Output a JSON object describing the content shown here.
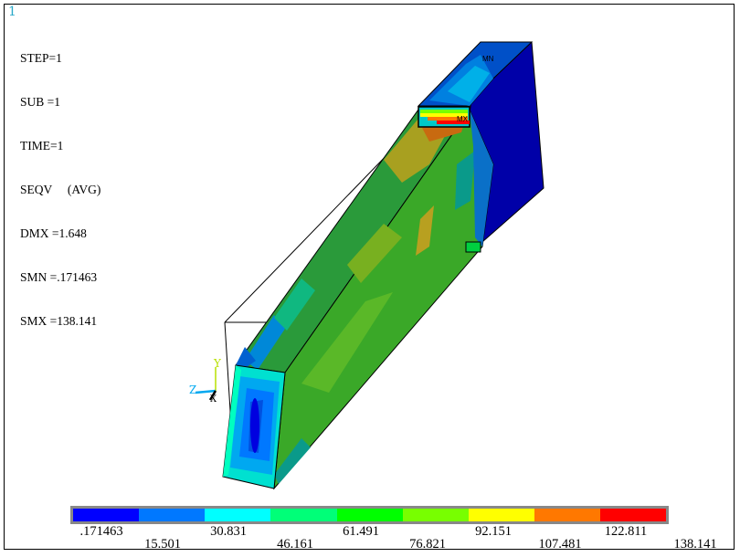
{
  "window_number": "1",
  "info": {
    "step": "STEP=1",
    "sub": "SUB =1",
    "time": "TIME=1",
    "result": "SEQV     (AVG)",
    "dmx": "DMX =1.648",
    "smn": "SMN =.171463",
    "smx": "SMX =138.141"
  },
  "markers": {
    "min": "MN",
    "max": "MX"
  },
  "triad": {
    "x": "X",
    "y": "Y",
    "z": "Z"
  },
  "colors": {
    "band_1": "#0000ff",
    "band_2": "#0078ff",
    "band_3": "#00ffff",
    "band_4": "#00ff78",
    "band_5": "#00ff00",
    "band_6": "#78ff00",
    "band_7": "#ffff00",
    "band_8": "#ff7800",
    "band_9": "#ff0000"
  },
  "legend": {
    "labels": [
      ".171463",
      "15.501",
      "30.831",
      "46.161",
      "61.491",
      "76.821",
      "92.151",
      "107.481",
      "122.811",
      "138.141"
    ]
  }
}
